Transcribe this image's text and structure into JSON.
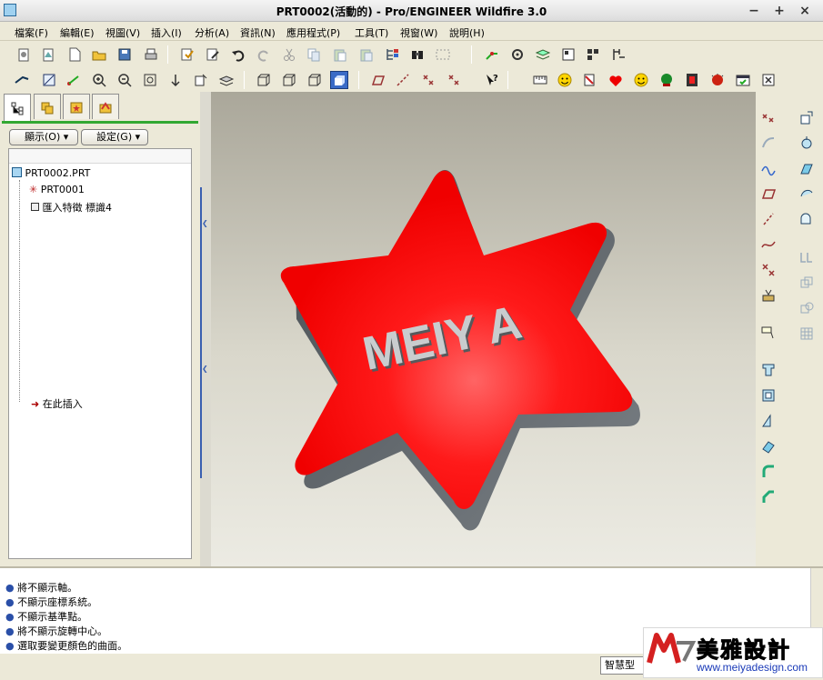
{
  "window": {
    "title": "PRT0002(活動的) - Pro/ENGINEER Wildfire 3.0",
    "controls": [
      "−",
      "+",
      "×"
    ]
  },
  "menu": [
    "檔案(F)",
    "編輯(E)",
    "視圖(V)",
    "插入(I)",
    "分析(A)",
    "資訊(N)",
    "應用程式(P)",
    "工具(T)",
    "視窗(W)",
    "說明(H)"
  ],
  "left_panel": {
    "display_button": "顯示(O)",
    "settings_button": "設定(G)",
    "tree": {
      "root": "PRT0002.PRT",
      "items": [
        "PRT0001",
        "匯入特徵 標識4"
      ],
      "insert_here": "在此插入"
    }
  },
  "model": {
    "text": "MEIY A",
    "color": "#ff0000"
  },
  "messages": [
    "將不顯示軸。",
    "不顯示座標系統。",
    "不顯示基準點。",
    "將不顯示旋轉中心。",
    "選取要變更顏色的曲面。"
  ],
  "status": {
    "filter": "智慧型"
  },
  "watermark": {
    "brand": "美雅設計",
    "url": "www.meiyadesign.com"
  }
}
